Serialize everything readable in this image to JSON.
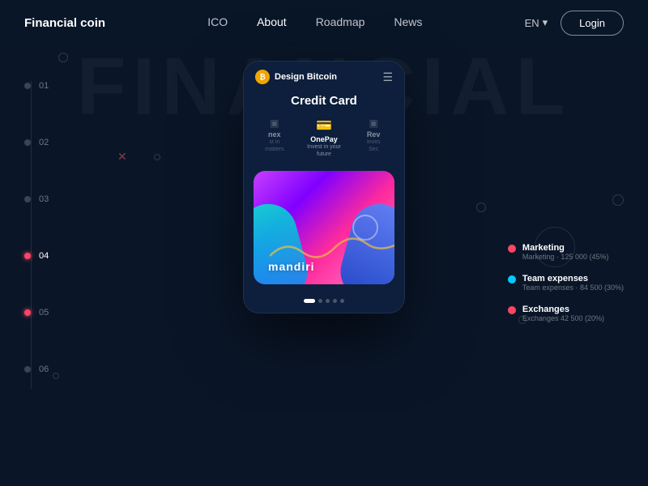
{
  "app": {
    "brand": "Financial coin",
    "watermark": "FINANCIAL"
  },
  "navbar": {
    "items": [
      {
        "label": "ICO",
        "active": false
      },
      {
        "label": "About",
        "active": true
      },
      {
        "label": "Roadmap",
        "active": false
      },
      {
        "label": "News",
        "active": false
      }
    ],
    "lang": "EN",
    "login_label": "Login"
  },
  "timeline": {
    "items": [
      {
        "label": "01",
        "active": false
      },
      {
        "label": "02",
        "active": false
      },
      {
        "label": "03",
        "active": false
      },
      {
        "label": "04",
        "active": true
      },
      {
        "label": "05",
        "active": false
      },
      {
        "label": "06",
        "active": false
      }
    ]
  },
  "phone": {
    "logo_text": "Design Bitcoin",
    "title": "Credit Card",
    "cards": [
      {
        "name": "nex",
        "desc": "st in\nmatters",
        "icon": "🃏",
        "side": true
      },
      {
        "name": "OnePay",
        "desc": "Invest in your\nfuture",
        "icon": "💳",
        "center": true
      },
      {
        "name": "Rev",
        "desc": "Inves\nSec",
        "icon": "🔖",
        "side": true
      }
    ],
    "main_card": {
      "brand": "mandiri"
    },
    "pagination": [
      {
        "active": true
      },
      {
        "active": false
      },
      {
        "active": false
      },
      {
        "active": false
      },
      {
        "active": false
      }
    ]
  },
  "legend": {
    "items": [
      {
        "label": "Marketing",
        "sub": "Marketing · 125 000 (45%)",
        "color": "#ff4466"
      },
      {
        "label": "Team expenses",
        "sub": "Team expenses · 84 500 (30%)",
        "color": "#00ccff"
      },
      {
        "label": "Exchanges",
        "sub": "Exchanges 42 500 (20%)",
        "color": "#ff4466"
      }
    ]
  }
}
